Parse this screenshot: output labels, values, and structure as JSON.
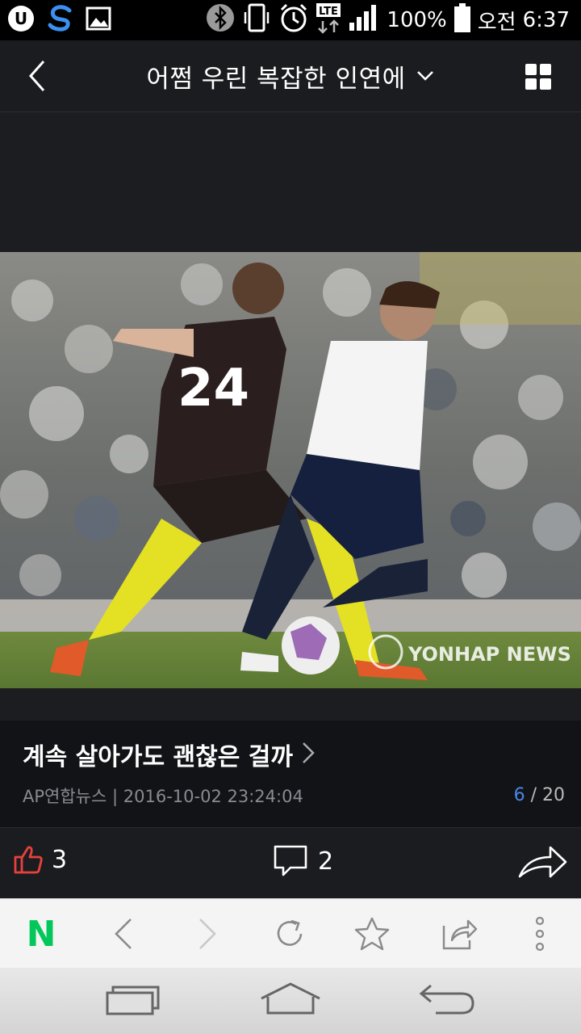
{
  "status_bar": {
    "battery": "100%",
    "network": "LTE",
    "ampm": "오전",
    "time": "6:37"
  },
  "header": {
    "title": "어쩜 우린 복잡한 인연에"
  },
  "photo": {
    "watermark": "YONHAP NEWS",
    "jersey_number": "24"
  },
  "article": {
    "title": "계속 살아가도 괜찮은 걸까",
    "source": "AP연합뉴스",
    "date": "2016-10-02 23:24:04",
    "page_current": "6",
    "page_separator": " / ",
    "page_total": "20"
  },
  "actions": {
    "like_count": "3",
    "comment_count": "2"
  },
  "browser": {
    "home_logo": "N"
  },
  "colors": {
    "accent_blue": "#4a86e8",
    "like_red": "#e8413c",
    "naver_green": "#03c75a"
  }
}
